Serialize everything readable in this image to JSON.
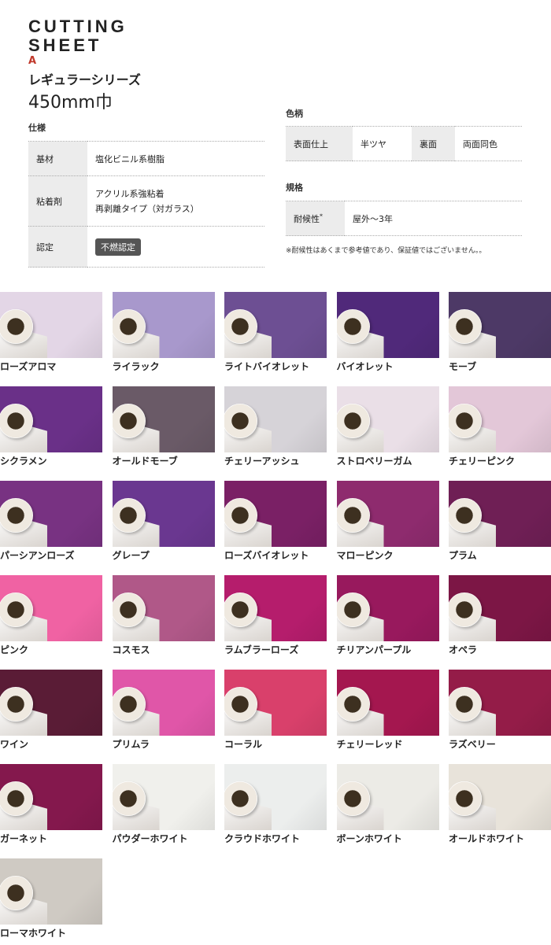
{
  "brand": {
    "line1": "CUTTING",
    "line2": "SHEET",
    "mark": "A"
  },
  "series": "レギュラーシリーズ",
  "width": "450mm巾",
  "spec": {
    "title": "仕様",
    "rows": [
      {
        "key": "基材",
        "value": "塩化ビニル系樹脂"
      },
      {
        "key": "粘着剤",
        "value": "アクリル系強粘着",
        "value2": "再剥離タイプ（対ガラス）"
      },
      {
        "key": "認定",
        "value": "不燃認定"
      }
    ]
  },
  "color": {
    "title": "色柄",
    "surface_key": "表面仕上",
    "surface_value": "半ツヤ",
    "back_key": "裏面",
    "back_value": "両面同色"
  },
  "standard": {
    "title": "規格",
    "key": "耐候性",
    "key_mark": "*",
    "value": "屋外～3年"
  },
  "note": "※耐候性はあくまで参考値であり、保証値ではございません。。",
  "swatches": [
    {
      "name": "ローズアロマ",
      "color": "#e3d6e6"
    },
    {
      "name": "ライラック",
      "color": "#a898cc"
    },
    {
      "name": "ライトバイオレット",
      "color": "#6d4f93"
    },
    {
      "name": "バイオレット",
      "color": "#50297a"
    },
    {
      "name": "モーブ",
      "color": "#4d3966"
    },
    {
      "name": "シクラメン",
      "color": "#6a3088"
    },
    {
      "name": "オールドモーブ",
      "color": "#6a5a67"
    },
    {
      "name": "チェリーアッシュ",
      "color": "#d6d3d8"
    },
    {
      "name": "ストロベリーガム",
      "color": "#eadfe7"
    },
    {
      "name": "チェリーピンク",
      "color": "#e3c7d8"
    },
    {
      "name": "パーシアンローズ",
      "color": "#783282"
    },
    {
      "name": "グレープ",
      "color": "#6a3790"
    },
    {
      "name": "ローズバイオレット",
      "color": "#7a2065"
    },
    {
      "name": "マローピンク",
      "color": "#8e2b6e"
    },
    {
      "name": "プラム",
      "color": "#6f1f55"
    },
    {
      "name": "ピンク",
      "color": "#f062a3"
    },
    {
      "name": "コスモス",
      "color": "#b05888"
    },
    {
      "name": "ラムブラーローズ",
      "color": "#b51d6c"
    },
    {
      "name": "チリアンパープル",
      "color": "#98195d"
    },
    {
      "name": "オペラ",
      "color": "#7c1645"
    },
    {
      "name": "ワイン",
      "color": "#5a1c36"
    },
    {
      "name": "プリムラ",
      "color": "#e056a8"
    },
    {
      "name": "コーラル",
      "color": "#d9406b"
    },
    {
      "name": "チェリーレッド",
      "color": "#a4174f"
    },
    {
      "name": "ラズベリー",
      "color": "#941c48"
    },
    {
      "name": "ガーネット",
      "color": "#84184d"
    },
    {
      "name": "パウダーホワイト",
      "color": "#f0f0ec"
    },
    {
      "name": "クラウドホワイト",
      "color": "#eceeed"
    },
    {
      "name": "ボーンホワイト",
      "color": "#ecebe6"
    },
    {
      "name": "オールドホワイト",
      "color": "#e8e3da"
    },
    {
      "name": "ローマホワイト",
      "color": "#cfcac3"
    }
  ]
}
